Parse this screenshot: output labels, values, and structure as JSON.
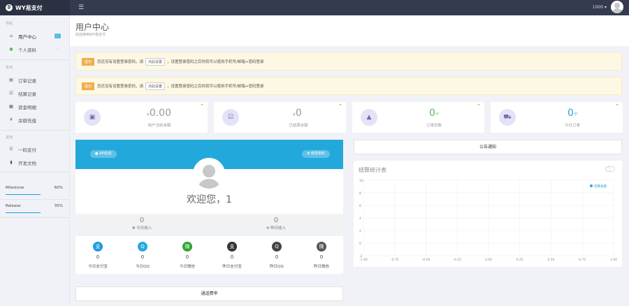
{
  "brand": {
    "name": "WY易支付"
  },
  "user": {
    "name": "1000 ▾"
  },
  "sidebar": {
    "nav_title": "导航",
    "items": [
      {
        "label": "用户中心"
      },
      {
        "label": "个人资料"
      }
    ],
    "query_title": "查询",
    "query_items": [
      {
        "label": "订单记录"
      },
      {
        "label": "结算记录"
      },
      {
        "label": "资金明细"
      },
      {
        "label": "余额充值"
      }
    ],
    "other_title": "其他",
    "other_items": [
      {
        "label": "一码支付"
      },
      {
        "label": "开发文档"
      }
    ],
    "milestones": [
      {
        "label": "Milestone",
        "percent": "60%",
        "value": 60
      },
      {
        "label": "Release",
        "percent": "35%",
        "value": 35
      }
    ]
  },
  "page": {
    "title": "用户中心",
    "subtitle": "欢迎使用WY易支付"
  },
  "alerts": [
    {
      "tag": "提示",
      "before": "您还没有设置登录密码，请",
      "button": "点此设置",
      "after": "，设置登录密码之后你就可以使用手机号/邮箱+密码登录"
    },
    {
      "tag": "提示",
      "before": "您还没有设置登录密码，请",
      "button": "点此设置",
      "after": "，设置登录密码之后你就可以使用手机号/邮箱+密码登录"
    }
  ],
  "stats": [
    {
      "currency": "¥",
      "value": "0.00",
      "unit": "",
      "label": "用户当前余额"
    },
    {
      "currency": "¥",
      "value": "0",
      "unit": "",
      "label": "已结算余额"
    },
    {
      "currency": "",
      "value": "0",
      "unit": "个",
      "label": "订单总数"
    },
    {
      "currency": "",
      "value": "0",
      "unit": "个",
      "label": "今日订单"
    }
  ],
  "profile": {
    "api_button": "API信息",
    "edit_button": "修改资料",
    "welcome": "欢迎您，1",
    "today_income": {
      "value": "0",
      "label": "今日收入"
    },
    "yesterday_income": {
      "value": "0",
      "label": "昨日收入"
    },
    "payments": [
      {
        "label": "今日支付宝",
        "value": "0",
        "icon": "alipay-icon",
        "color": "#1d9be0",
        "glyph": "支"
      },
      {
        "label": "今日QQ",
        "value": "0",
        "icon": "qq-icon",
        "color": "#23a8dc",
        "glyph": "Q"
      },
      {
        "label": "今日微信",
        "value": "0",
        "icon": "wechat-icon",
        "color": "#2ea52e",
        "glyph": "微"
      },
      {
        "label": "昨日支付宝",
        "value": "0",
        "icon": "alipay-icon",
        "color": "#333333",
        "glyph": "支"
      },
      {
        "label": "昨日QQ",
        "value": "0",
        "icon": "qq-icon",
        "color": "#444444",
        "glyph": "Q"
      },
      {
        "label": "昨日微信",
        "value": "0",
        "icon": "wechat-icon",
        "color": "#555555",
        "glyph": "微"
      }
    ]
  },
  "rate_button": "通道费率",
  "notice_title": "公告通知",
  "chart_data": {
    "type": "line",
    "title": "结算统计表",
    "legend": [
      "结算金额"
    ],
    "legend_position": "top-right",
    "series": [
      {
        "name": "结算金额",
        "values": []
      }
    ],
    "x_ticks": [
      "-1.00",
      "-0.75",
      "-0.50",
      "-0.25",
      "0.00",
      "0.25",
      "0.50",
      "0.75",
      "1.00"
    ],
    "y_ticks": [
      "10",
      "8",
      "6",
      "4",
      "2",
      "0",
      "-2"
    ],
    "xlim": [
      -1,
      1
    ],
    "ylim": [
      -2,
      10
    ],
    "grid": true,
    "colors": {
      "legend": "#23a8dc"
    }
  }
}
